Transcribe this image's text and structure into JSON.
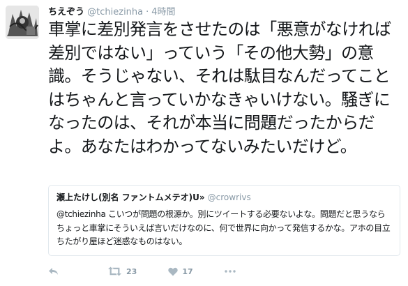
{
  "tweet": {
    "display_name": "ちえぞう",
    "handle": "@tchiezinha",
    "separator": "·",
    "time": "4時間",
    "text": "車掌に差別発言をさせたのは「悪意がなければ差別ではない」っていう「その他大勢」の意識。そうじゃない、それは駄目なんだってことはちゃんと言っていかなきゃいけない。騒ぎになったのは、それが本当に問題だったからだよ。あなたはわかってないみたいだけど。"
  },
  "quote": {
    "display_name": "瀬上たけし(別名 ファントムメテオ)U»",
    "handle": "@crowrivs",
    "text": "@tchiezinha こいつが問題の根源か。別にツイートする必要ないよな。問題だと思うならちょっと車掌にそういえば言いだけなのに、何で世界に向かって発信するかな。アホの目立ちたがり屋ほど迷惑なものはない。"
  },
  "actions": {
    "retweet_count": "23",
    "like_count": "17"
  },
  "icons": {
    "reply": "reply-icon",
    "retweet": "retweet-icon",
    "like": "heart-icon",
    "more": "more-icon"
  },
  "colors": {
    "text": "#14171a",
    "muted": "#8899a6",
    "icon": "#aab8c2",
    "border": "#e1e8ed"
  }
}
